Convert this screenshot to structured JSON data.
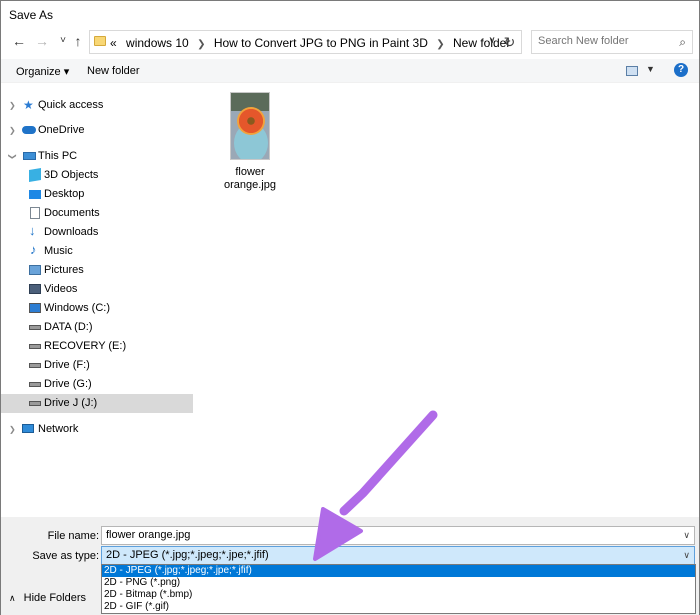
{
  "window": {
    "title": "Save As"
  },
  "nav": {
    "back": "←",
    "forward": "→",
    "recent": "˅",
    "up": "↑"
  },
  "address": {
    "crumbs": [
      "windows 10",
      "How to Convert JPG to PNG in Paint 3D",
      "New folder"
    ],
    "overflow": "«"
  },
  "search": {
    "placeholder": "Search New folder"
  },
  "toolbar": {
    "organize": "Organize ▾",
    "new_folder": "New folder",
    "help": "?"
  },
  "sidebar": {
    "items": [
      {
        "label": "Quick access",
        "icon": "star-icon"
      },
      {
        "label": "OneDrive",
        "icon": "cloud-icon"
      },
      {
        "label": "This PC",
        "icon": "computer-icon"
      },
      {
        "label": "3D Objects",
        "icon": "cube-icon"
      },
      {
        "label": "Desktop",
        "icon": "desktop-icon"
      },
      {
        "label": "Documents",
        "icon": "document-icon"
      },
      {
        "label": "Downloads",
        "icon": "download-icon"
      },
      {
        "label": "Music",
        "icon": "music-icon"
      },
      {
        "label": "Pictures",
        "icon": "picture-icon"
      },
      {
        "label": "Videos",
        "icon": "video-icon"
      },
      {
        "label": "Windows (C:)",
        "icon": "drive-icon"
      },
      {
        "label": "DATA (D:)",
        "icon": "drive-icon"
      },
      {
        "label": "RECOVERY (E:)",
        "icon": "drive-icon"
      },
      {
        "label": "Drive (F:)",
        "icon": "drive-icon"
      },
      {
        "label": "Drive (G:)",
        "icon": "drive-icon"
      },
      {
        "label": "Drive J (J:)",
        "icon": "drive-icon"
      },
      {
        "label": "Network",
        "icon": "network-icon"
      }
    ]
  },
  "files": [
    {
      "name_line1": "flower",
      "name_line2": "orange.jpg"
    }
  ],
  "form": {
    "file_name_label": "File name:",
    "file_name_value": "flower orange.jpg",
    "save_type_label": "Save as type:",
    "save_type_value": "2D - JPEG (*.jpg;*.jpeg;*.jpe;*.jfif)",
    "type_options": [
      "2D - JPEG (*.jpg;*.jpeg;*.jpe;*.jfif)",
      "2D - PNG (*.png)",
      "2D - Bitmap (*.bmp)",
      "2D - GIF (*.gif)"
    ]
  },
  "footer": {
    "hide_folders": "Hide Folders"
  },
  "colors": {
    "accent": "#0078d7",
    "annotation_arrow": "#b06be8"
  }
}
